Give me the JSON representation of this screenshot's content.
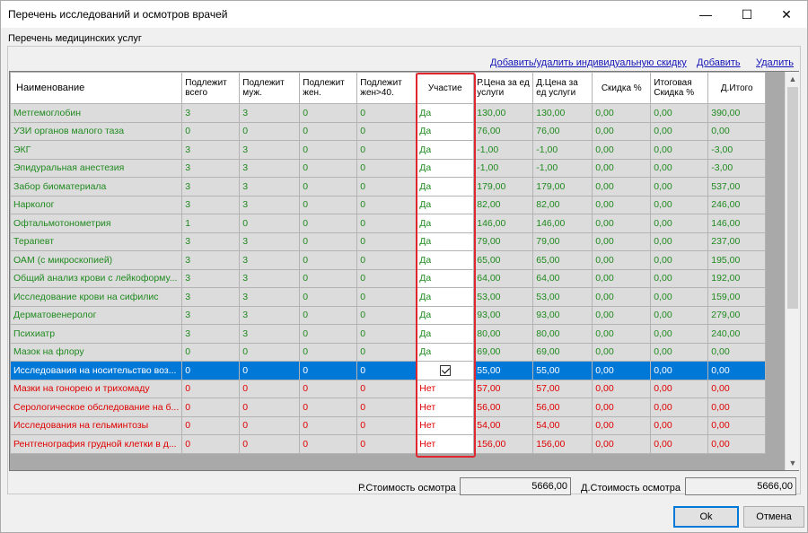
{
  "window": {
    "title": "Перечень исследований и осмотров врачей",
    "minimize_glyph": "—",
    "maximize_glyph": "☐",
    "close_glyph": "✕"
  },
  "section_label": "Перечень медицинских услуг",
  "links": {
    "discount": "Добавить/удалить индивидуальную скидку",
    "add": "Добавить",
    "delete": "Удалить"
  },
  "table": {
    "columns": [
      "Наименование",
      "Подлежит всего",
      "Подлежит муж.",
      "Подлежит жен.",
      "Подлежит жен>40.",
      "Участие",
      "Р.Цена за ед услуги",
      "Д.Цена за ед услуги",
      "Скидка %",
      "Итоговая Скидка %",
      "Д.Итого"
    ],
    "rows": [
      {
        "cells": [
          "Метгемоглобин",
          "3",
          "3",
          "0",
          "0",
          "Да",
          "130,00",
          "130,00",
          "0,00",
          "0,00",
          "390,00"
        ],
        "status": "green"
      },
      {
        "cells": [
          "УЗИ органов малого таза",
          "0",
          "0",
          "0",
          "0",
          "Да",
          "76,00",
          "76,00",
          "0,00",
          "0,00",
          "0,00"
        ],
        "status": "green"
      },
      {
        "cells": [
          "ЭКГ",
          "3",
          "3",
          "0",
          "0",
          "Да",
          "-1,00",
          "-1,00",
          "0,00",
          "0,00",
          "-3,00"
        ],
        "status": "green"
      },
      {
        "cells": [
          "Эпидуральная анестезия",
          "3",
          "3",
          "0",
          "0",
          "Да",
          "-1,00",
          "-1,00",
          "0,00",
          "0,00",
          "-3,00"
        ],
        "status": "green"
      },
      {
        "cells": [
          "Забор биоматериала",
          "3",
          "3",
          "0",
          "0",
          "Да",
          "179,00",
          "179,00",
          "0,00",
          "0,00",
          "537,00"
        ],
        "status": "green"
      },
      {
        "cells": [
          "Нарколог",
          "3",
          "3",
          "0",
          "0",
          "Да",
          "82,00",
          "82,00",
          "0,00",
          "0,00",
          "246,00"
        ],
        "status": "green"
      },
      {
        "cells": [
          "Офтальмотонометрия",
          "1",
          "0",
          "0",
          "0",
          "Да",
          "146,00",
          "146,00",
          "0,00",
          "0,00",
          "146,00"
        ],
        "status": "green"
      },
      {
        "cells": [
          "Терапевт",
          "3",
          "3",
          "0",
          "0",
          "Да",
          "79,00",
          "79,00",
          "0,00",
          "0,00",
          "237,00"
        ],
        "status": "green"
      },
      {
        "cells": [
          "ОАМ (с микроскопией)",
          "3",
          "3",
          "0",
          "0",
          "Да",
          "65,00",
          "65,00",
          "0,00",
          "0,00",
          "195,00"
        ],
        "status": "green"
      },
      {
        "cells": [
          "Общий анализ крови с лейкоформу...",
          "3",
          "3",
          "0",
          "0",
          "Да",
          "64,00",
          "64,00",
          "0,00",
          "0,00",
          "192,00"
        ],
        "status": "green"
      },
      {
        "cells": [
          "Исследование крови на сифилис",
          "3",
          "3",
          "0",
          "0",
          "Да",
          "53,00",
          "53,00",
          "0,00",
          "0,00",
          "159,00"
        ],
        "status": "green"
      },
      {
        "cells": [
          "Дерматовенеролог",
          "3",
          "3",
          "0",
          "0",
          "Да",
          "93,00",
          "93,00",
          "0,00",
          "0,00",
          "279,00"
        ],
        "status": "green"
      },
      {
        "cells": [
          "Психиатр",
          "3",
          "3",
          "0",
          "0",
          "Да",
          "80,00",
          "80,00",
          "0,00",
          "0,00",
          "240,00"
        ],
        "status": "green"
      },
      {
        "cells": [
          "Мазок на флору",
          "0",
          "0",
          "0",
          "0",
          "Да",
          "69,00",
          "69,00",
          "0,00",
          "0,00",
          "0,00"
        ],
        "status": "green"
      },
      {
        "cells": [
          "Исследования на носительство воз...",
          "0",
          "0",
          "0",
          "0",
          "",
          "55,00",
          "55,00",
          "0,00",
          "0,00",
          "0,00"
        ],
        "status": "selected"
      },
      {
        "cells": [
          "Мазки на гонорею и трихомаду",
          "0",
          "0",
          "0",
          "0",
          "Нет",
          "57,00",
          "57,00",
          "0,00",
          "0,00",
          "0,00"
        ],
        "status": "red"
      },
      {
        "cells": [
          "Серологическое обследование на б...",
          "0",
          "0",
          "0",
          "0",
          "Нет",
          "56,00",
          "56,00",
          "0,00",
          "0,00",
          "0,00"
        ],
        "status": "red"
      },
      {
        "cells": [
          "Исследования на гельминтозы",
          "0",
          "0",
          "0",
          "0",
          "Нет",
          "54,00",
          "54,00",
          "0,00",
          "0,00",
          "0,00"
        ],
        "status": "red"
      },
      {
        "cells": [
          "Рентгенография грудной клетки в д...",
          "0",
          "0",
          "0",
          "0",
          "Нет",
          "156,00",
          "156,00",
          "0,00",
          "0,00",
          "0,00"
        ],
        "status": "red"
      }
    ]
  },
  "totals": {
    "r_label": "Р.Стоимость осмотра",
    "r_value": "5666,00",
    "d_label": "Д.Стоимость осмотра",
    "d_value": "5666,00"
  },
  "buttons": {
    "ok": "Ok",
    "cancel": "Отмена"
  },
  "colors": {
    "participating": "#1f8a1f",
    "not_participating": "#e00000",
    "selection": "#0078d7",
    "highlight_box": "#e0272f"
  }
}
